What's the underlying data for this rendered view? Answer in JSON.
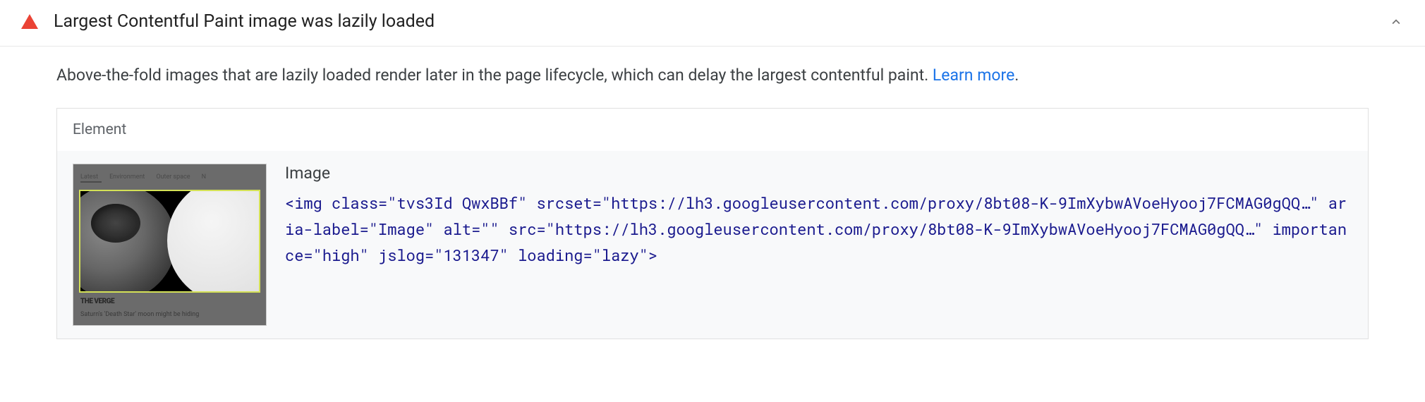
{
  "audit": {
    "title": "Largest Contentful Paint image was lazily loaded",
    "description_text": "Above-the-fold images that are lazily loaded render later in the page lifecycle, which can delay the largest contentful paint. ",
    "learn_more": "Learn more",
    "period": "."
  },
  "table": {
    "header": "Element",
    "row": {
      "element_label": "Image",
      "code_parts": {
        "open": "<",
        "tag": "img",
        "space": " ",
        "attr_class": "class",
        "eq": "=",
        "q": "\"",
        "val_class": "tvs3Id QwxBBf",
        "attr_srcset": "srcset",
        "val_srcset": "https://lh3.googleusercontent.com/proxy/8bt08-K-9ImXybwAVoeHyooj7FCMAG0gQQ…",
        "attr_arialabel": "aria-label",
        "val_arialabel": "Image",
        "attr_alt": "alt",
        "val_alt": "",
        "attr_src": "src",
        "val_src": "https://lh3.googleusercontent.com/proxy/8bt08-K-9ImXybwAVoeHyooj7FCMAG0gQQ…",
        "attr_importance": "importance",
        "val_importance": "high",
        "attr_jslog": "jslog",
        "val_jslog": "131347",
        "attr_loading": "loading",
        "val_loading": "lazy",
        "close": ">"
      }
    },
    "thumbnail": {
      "nav_items": [
        "Latest",
        "Environment",
        "Outer space",
        "N"
      ],
      "brand": "THE VERGE",
      "caption": "Saturn's 'Death Star' moon might be hiding"
    }
  }
}
